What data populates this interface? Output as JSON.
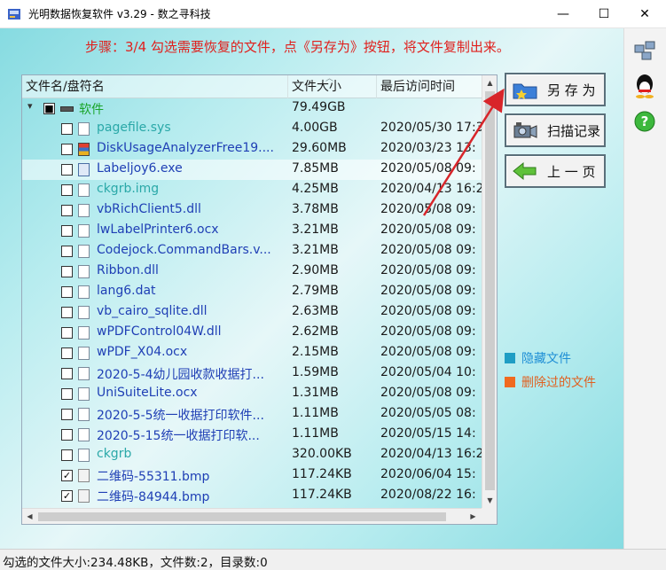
{
  "window": {
    "title": "光明数据恢复软件 v3.29 - 数之寻科技",
    "minimize": "—",
    "maximize": "☐",
    "close": "✕"
  },
  "step_text": "步骤：3/4 勾选需要恢复的文件，点《另存为》按钮，将文件复制出来。",
  "columns": {
    "name": "文件名/盘符名",
    "size": "文件大小",
    "date": "最后访问时间"
  },
  "rows": [
    {
      "name": "软件",
      "size": "79.49GB",
      "date": "",
      "check": "■",
      "icon": "drive",
      "color": "green",
      "indent": 0
    },
    {
      "name": "pagefile.sys",
      "size": "4.00GB",
      "date": "2020/05/30 17:3",
      "check": "",
      "icon": "file",
      "color": "teal",
      "indent": 1
    },
    {
      "name": "DiskUsageAnalyzerFree19....",
      "size": "29.60MB",
      "date": "2020/03/23 13:",
      "check": "",
      "icon": "app",
      "color": "blue",
      "indent": 1
    },
    {
      "name": "Labeljoy6.exe",
      "size": "7.85MB",
      "date": "2020/05/08 09:",
      "check": "",
      "icon": "exe",
      "color": "blue",
      "indent": 1,
      "selected": true
    },
    {
      "name": "ckgrb.img",
      "size": "4.25MB",
      "date": "2020/04/13 16:2",
      "check": "",
      "icon": "file",
      "color": "teal",
      "indent": 1
    },
    {
      "name": "vbRichClient5.dll",
      "size": "3.78MB",
      "date": "2020/05/08 09:",
      "check": "",
      "icon": "file",
      "color": "blue",
      "indent": 1
    },
    {
      "name": "lwLabelPrinter6.ocx",
      "size": "3.21MB",
      "date": "2020/05/08 09:",
      "check": "",
      "icon": "file",
      "color": "blue",
      "indent": 1
    },
    {
      "name": "Codejock.CommandBars.v...",
      "size": "3.21MB",
      "date": "2020/05/08 09:",
      "check": "",
      "icon": "file",
      "color": "blue",
      "indent": 1
    },
    {
      "name": "Ribbon.dll",
      "size": "2.90MB",
      "date": "2020/05/08 09:",
      "check": "",
      "icon": "file",
      "color": "blue",
      "indent": 1
    },
    {
      "name": "lang6.dat",
      "size": "2.79MB",
      "date": "2020/05/08 09:",
      "check": "",
      "icon": "file",
      "color": "blue",
      "indent": 1
    },
    {
      "name": "vb_cairo_sqlite.dll",
      "size": "2.63MB",
      "date": "2020/05/08 09:",
      "check": "",
      "icon": "file",
      "color": "blue",
      "indent": 1
    },
    {
      "name": "wPDFControl04W.dll",
      "size": "2.62MB",
      "date": "2020/05/08 09:",
      "check": "",
      "icon": "file",
      "color": "blue",
      "indent": 1
    },
    {
      "name": "wPDF_X04.ocx",
      "size": "2.15MB",
      "date": "2020/05/08 09:",
      "check": "",
      "icon": "file",
      "color": "blue",
      "indent": 1
    },
    {
      "name": "2020-5-4幼儿园收款收据打...",
      "size": "1.59MB",
      "date": "2020/05/04 10:",
      "check": "",
      "icon": "file",
      "color": "blue",
      "indent": 1
    },
    {
      "name": "UniSuiteLite.ocx",
      "size": "1.31MB",
      "date": "2020/05/08 09:",
      "check": "",
      "icon": "file",
      "color": "blue",
      "indent": 1
    },
    {
      "name": "2020-5-5统一收据打印软件...",
      "size": "1.11MB",
      "date": "2020/05/05 08:",
      "check": "",
      "icon": "file",
      "color": "blue",
      "indent": 1
    },
    {
      "name": "2020-5-15统一收据打印软...",
      "size": "1.11MB",
      "date": "2020/05/15 14:",
      "check": "",
      "icon": "file",
      "color": "blue",
      "indent": 1
    },
    {
      "name": "ckgrb",
      "size": "320.00KB",
      "date": "2020/04/13 16:2",
      "check": "",
      "icon": "file",
      "color": "teal",
      "indent": 1
    },
    {
      "name": "二维码-55311.bmp",
      "size": "117.24KB",
      "date": "2020/06/04 15:",
      "check": "✓",
      "icon": "bmp",
      "color": "blue",
      "indent": 1
    },
    {
      "name": "二维码-84944.bmp",
      "size": "117.24KB",
      "date": "2020/08/22 16:",
      "check": "✓",
      "icon": "bmp",
      "color": "blue",
      "indent": 1
    }
  ],
  "tree_toggle": "▾",
  "buttons": {
    "save": "另 存 为",
    "scan": "扫描记录",
    "back": "上 一 页"
  },
  "legend": {
    "hidden": "隐藏文件",
    "deleted": "删除过的文件",
    "hidden_color": "#1f9dc4",
    "deleted_color": "#f06a20"
  },
  "status": "勾选的文件大小:234.48KB，文件数:2，目录数:0",
  "scroll": {
    "up": "▲",
    "down": "▼",
    "left": "◀",
    "right": "▶"
  },
  "colors": {
    "step": "#e0201d",
    "name_blue": "#1f3fb5",
    "name_green": "#1aa52a",
    "arrow": "#d8252a"
  }
}
